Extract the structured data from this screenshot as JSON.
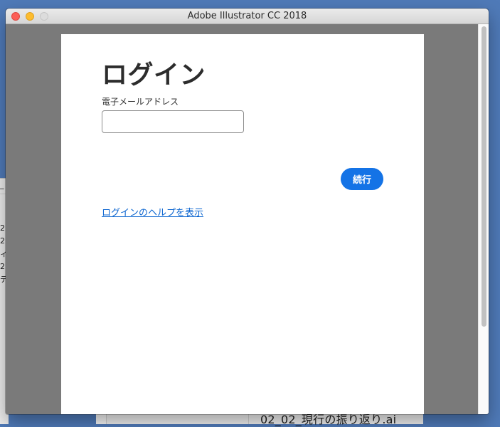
{
  "window": {
    "title": "Adobe Illustrator CC 2018"
  },
  "login": {
    "heading": "ログイン",
    "email_label": "電子メールアドレス",
    "email_value": "",
    "continue_label": "続行",
    "help_link": "ログインのヘルプを表示"
  },
  "background": {
    "left_fragments": [
      "_",
      "",
      "",
      "2",
      "2",
      "ィ",
      "2",
      "デ"
    ],
    "bottom_filename": "02_02_現行の振り返り.ai"
  },
  "colors": {
    "accent": "#1473e6",
    "link": "#0d66d0",
    "desktop": "#4f7ab8"
  }
}
